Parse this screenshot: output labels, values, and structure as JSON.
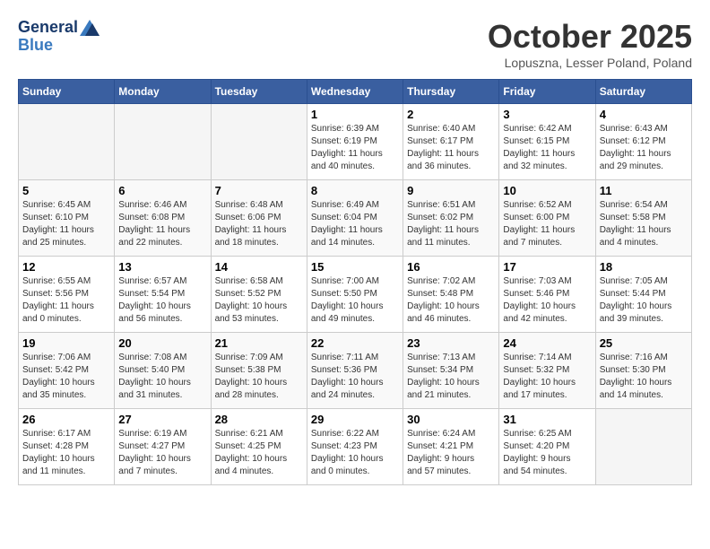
{
  "header": {
    "logo_line1": "General",
    "logo_line2": "Blue",
    "month": "October 2025",
    "location": "Lopuszna, Lesser Poland, Poland"
  },
  "days_of_week": [
    "Sunday",
    "Monday",
    "Tuesday",
    "Wednesday",
    "Thursday",
    "Friday",
    "Saturday"
  ],
  "weeks": [
    [
      {
        "num": "",
        "info": ""
      },
      {
        "num": "",
        "info": ""
      },
      {
        "num": "",
        "info": ""
      },
      {
        "num": "1",
        "info": "Sunrise: 6:39 AM\nSunset: 6:19 PM\nDaylight: 11 hours\nand 40 minutes."
      },
      {
        "num": "2",
        "info": "Sunrise: 6:40 AM\nSunset: 6:17 PM\nDaylight: 11 hours\nand 36 minutes."
      },
      {
        "num": "3",
        "info": "Sunrise: 6:42 AM\nSunset: 6:15 PM\nDaylight: 11 hours\nand 32 minutes."
      },
      {
        "num": "4",
        "info": "Sunrise: 6:43 AM\nSunset: 6:12 PM\nDaylight: 11 hours\nand 29 minutes."
      }
    ],
    [
      {
        "num": "5",
        "info": "Sunrise: 6:45 AM\nSunset: 6:10 PM\nDaylight: 11 hours\nand 25 minutes."
      },
      {
        "num": "6",
        "info": "Sunrise: 6:46 AM\nSunset: 6:08 PM\nDaylight: 11 hours\nand 22 minutes."
      },
      {
        "num": "7",
        "info": "Sunrise: 6:48 AM\nSunset: 6:06 PM\nDaylight: 11 hours\nand 18 minutes."
      },
      {
        "num": "8",
        "info": "Sunrise: 6:49 AM\nSunset: 6:04 PM\nDaylight: 11 hours\nand 14 minutes."
      },
      {
        "num": "9",
        "info": "Sunrise: 6:51 AM\nSunset: 6:02 PM\nDaylight: 11 hours\nand 11 minutes."
      },
      {
        "num": "10",
        "info": "Sunrise: 6:52 AM\nSunset: 6:00 PM\nDaylight: 11 hours\nand 7 minutes."
      },
      {
        "num": "11",
        "info": "Sunrise: 6:54 AM\nSunset: 5:58 PM\nDaylight: 11 hours\nand 4 minutes."
      }
    ],
    [
      {
        "num": "12",
        "info": "Sunrise: 6:55 AM\nSunset: 5:56 PM\nDaylight: 11 hours\nand 0 minutes."
      },
      {
        "num": "13",
        "info": "Sunrise: 6:57 AM\nSunset: 5:54 PM\nDaylight: 10 hours\nand 56 minutes."
      },
      {
        "num": "14",
        "info": "Sunrise: 6:58 AM\nSunset: 5:52 PM\nDaylight: 10 hours\nand 53 minutes."
      },
      {
        "num": "15",
        "info": "Sunrise: 7:00 AM\nSunset: 5:50 PM\nDaylight: 10 hours\nand 49 minutes."
      },
      {
        "num": "16",
        "info": "Sunrise: 7:02 AM\nSunset: 5:48 PM\nDaylight: 10 hours\nand 46 minutes."
      },
      {
        "num": "17",
        "info": "Sunrise: 7:03 AM\nSunset: 5:46 PM\nDaylight: 10 hours\nand 42 minutes."
      },
      {
        "num": "18",
        "info": "Sunrise: 7:05 AM\nSunset: 5:44 PM\nDaylight: 10 hours\nand 39 minutes."
      }
    ],
    [
      {
        "num": "19",
        "info": "Sunrise: 7:06 AM\nSunset: 5:42 PM\nDaylight: 10 hours\nand 35 minutes."
      },
      {
        "num": "20",
        "info": "Sunrise: 7:08 AM\nSunset: 5:40 PM\nDaylight: 10 hours\nand 31 minutes."
      },
      {
        "num": "21",
        "info": "Sunrise: 7:09 AM\nSunset: 5:38 PM\nDaylight: 10 hours\nand 28 minutes."
      },
      {
        "num": "22",
        "info": "Sunrise: 7:11 AM\nSunset: 5:36 PM\nDaylight: 10 hours\nand 24 minutes."
      },
      {
        "num": "23",
        "info": "Sunrise: 7:13 AM\nSunset: 5:34 PM\nDaylight: 10 hours\nand 21 minutes."
      },
      {
        "num": "24",
        "info": "Sunrise: 7:14 AM\nSunset: 5:32 PM\nDaylight: 10 hours\nand 17 minutes."
      },
      {
        "num": "25",
        "info": "Sunrise: 7:16 AM\nSunset: 5:30 PM\nDaylight: 10 hours\nand 14 minutes."
      }
    ],
    [
      {
        "num": "26",
        "info": "Sunrise: 6:17 AM\nSunset: 4:28 PM\nDaylight: 10 hours\nand 11 minutes."
      },
      {
        "num": "27",
        "info": "Sunrise: 6:19 AM\nSunset: 4:27 PM\nDaylight: 10 hours\nand 7 minutes."
      },
      {
        "num": "28",
        "info": "Sunrise: 6:21 AM\nSunset: 4:25 PM\nDaylight: 10 hours\nand 4 minutes."
      },
      {
        "num": "29",
        "info": "Sunrise: 6:22 AM\nSunset: 4:23 PM\nDaylight: 10 hours\nand 0 minutes."
      },
      {
        "num": "30",
        "info": "Sunrise: 6:24 AM\nSunset: 4:21 PM\nDaylight: 9 hours\nand 57 minutes."
      },
      {
        "num": "31",
        "info": "Sunrise: 6:25 AM\nSunset: 4:20 PM\nDaylight: 9 hours\nand 54 minutes."
      },
      {
        "num": "",
        "info": ""
      }
    ]
  ]
}
